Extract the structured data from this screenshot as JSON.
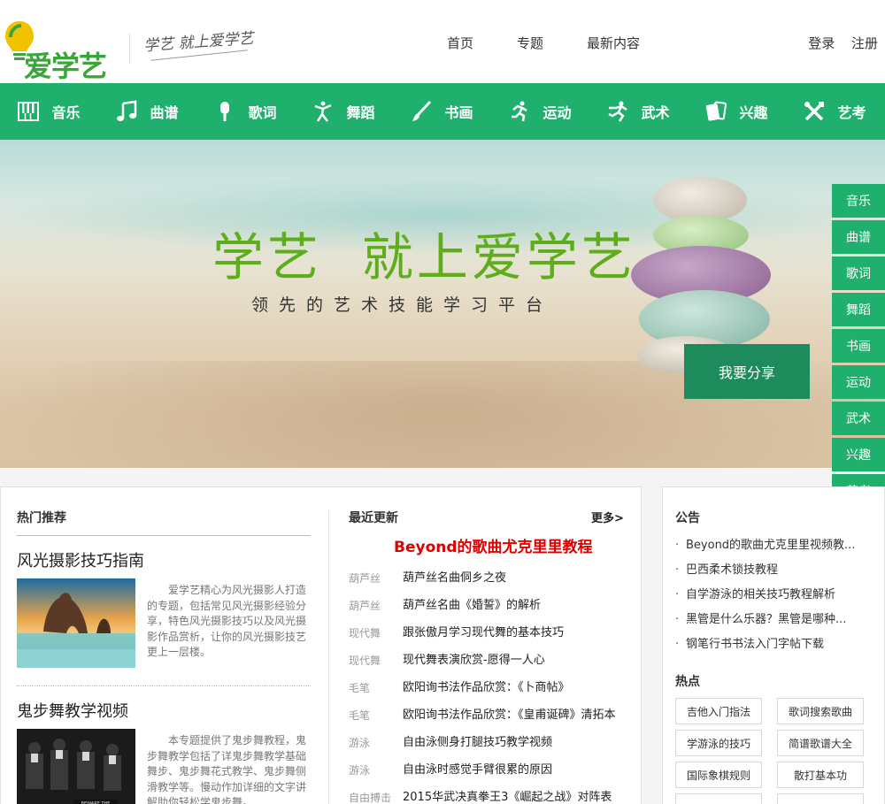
{
  "header": {
    "logo_text": "爱学艺",
    "slogan": "学艺 就上爱学艺",
    "nav": [
      "首页",
      "专题",
      "最新内容"
    ],
    "login": "登录",
    "register": "注册"
  },
  "categories": [
    {
      "label": "音乐",
      "icon": "piano-icon"
    },
    {
      "label": "曲谱",
      "icon": "music-note-icon"
    },
    {
      "label": "歌词",
      "icon": "microphone-icon"
    },
    {
      "label": "舞蹈",
      "icon": "dancer-icon"
    },
    {
      "label": "书画",
      "icon": "brush-icon"
    },
    {
      "label": "运动",
      "icon": "runner-icon"
    },
    {
      "label": "武术",
      "icon": "martial-arts-icon"
    },
    {
      "label": "兴趣",
      "icon": "cards-icon"
    },
    {
      "label": "艺考",
      "icon": "tools-icon"
    }
  ],
  "banner": {
    "title": "学艺  就上爱学艺",
    "subtitle": "领先的艺术技能学习平台",
    "share_button": "我要分享"
  },
  "sidemenu": [
    "音乐",
    "曲谱",
    "歌词",
    "舞蹈",
    "书画",
    "运动",
    "武术",
    "兴趣",
    "艺考"
  ],
  "hot": {
    "heading": "热门推荐",
    "topics": [
      {
        "title": "风光摄影技巧指南",
        "desc": "爱学艺精心为风光摄影人打造的专题，包括常见风光摄影经验分享，特色风光摄影技巧以及风光摄影作品赏析，让你的风光摄影技艺更上一层楼。"
      },
      {
        "title": "鬼步舞教学视频",
        "desc": "本专题提供了鬼步舞教程，鬼步舞教学包括了详鬼步舞教学基础舞步、鬼步舞花式教学、鬼步舞侧滑教学等。慢动作加详细的文字讲解助你轻松学鬼步舞。"
      }
    ]
  },
  "latest": {
    "heading": "最近更新",
    "more": "更多>",
    "headline": "Beyond的歌曲尤克里里教程",
    "items": [
      {
        "cat": "葫芦丝",
        "title": "葫芦丝名曲侗乡之夜"
      },
      {
        "cat": "葫芦丝",
        "title": "葫芦丝名曲《婚誓》的解析"
      },
      {
        "cat": "现代舞",
        "title": "跟张傲月学习现代舞的基本技巧"
      },
      {
        "cat": "现代舞",
        "title": "现代舞表演欣赏-愿得一人心"
      },
      {
        "cat": "毛笔",
        "title": "欧阳询书法作品欣赏：《卜商帖》"
      },
      {
        "cat": "毛笔",
        "title": "欧阳询书法作品欣赏：《皇甫诞碑》清拓本"
      },
      {
        "cat": "游泳",
        "title": "自由泳侧身打腿技巧教学视频"
      },
      {
        "cat": "游泳",
        "title": "自由泳时感觉手臂很累的原因"
      },
      {
        "cat": "自由搏击",
        "title": "2015华武决真拳王3《崛起之战》对阵表"
      }
    ]
  },
  "notice": {
    "heading": "公告",
    "items": [
      "Beyond的歌曲尤克里里视频教...",
      "巴西柔术锁技教程",
      "自学游泳的相关技巧教程解析",
      "黑管是什么乐器？黑管是哪种...",
      "钢笔行书书法入门字帖下载"
    ]
  },
  "hotspot": {
    "heading": "热点",
    "tags": [
      "吉他入门指法",
      "歌词搜索歌曲",
      "学游泳的技巧",
      "简谱歌谱大全",
      "国际象棋规则",
      "散打基本功"
    ]
  },
  "colors": {
    "brand_green": "#1fb06d",
    "dark_green": "#1e8b5c",
    "headline_red": "#e00000",
    "banner_text_green": "#5eae1c"
  }
}
